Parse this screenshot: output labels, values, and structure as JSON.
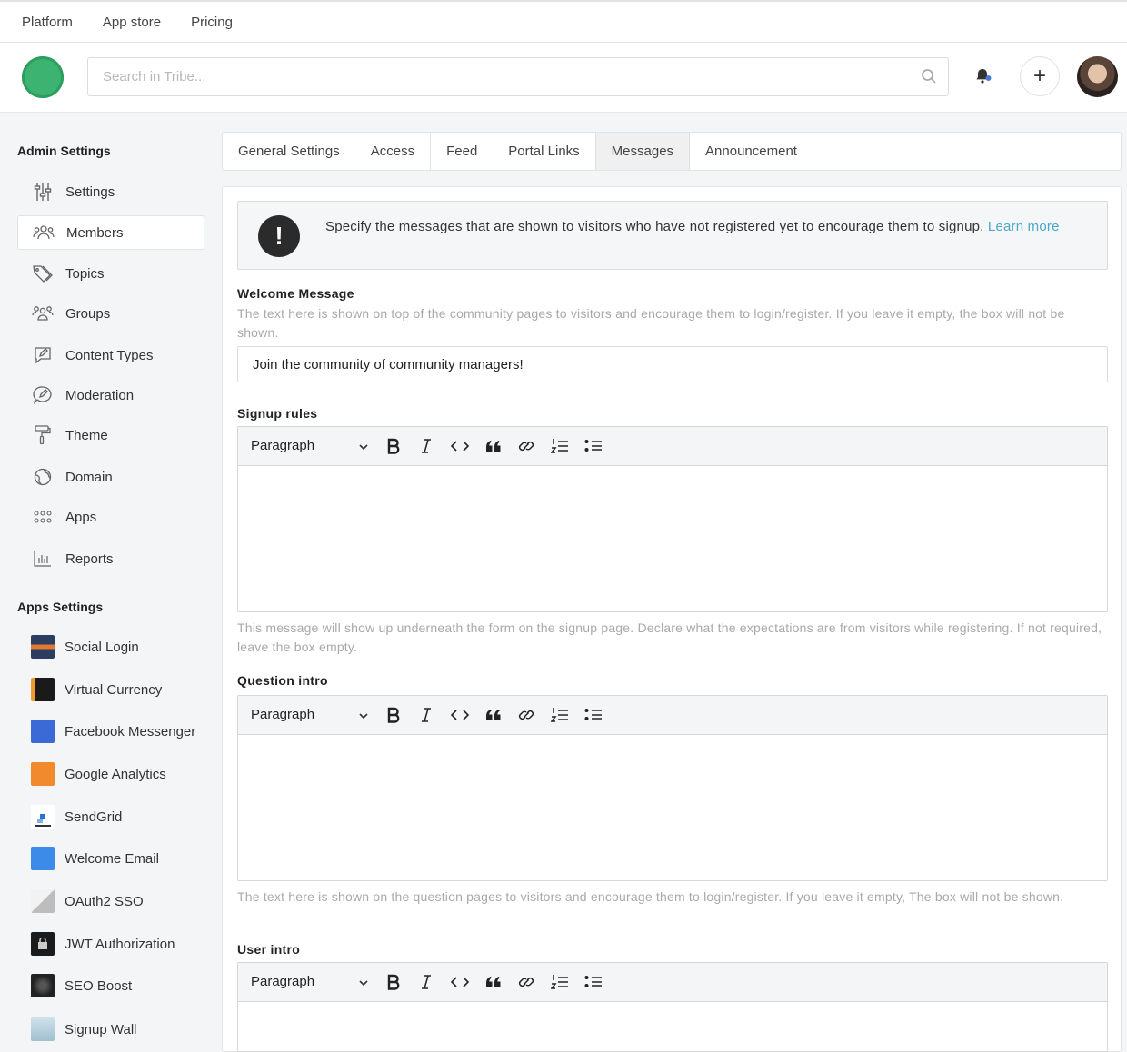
{
  "topnav": {
    "items": [
      "Platform",
      "App store",
      "Pricing"
    ]
  },
  "header": {
    "search_placeholder": "Search in Tribe...",
    "plus_label": "+"
  },
  "sidebar": {
    "admin_heading": "Admin Settings",
    "admin_items": [
      {
        "label": "Settings",
        "icon": "sliders-icon"
      },
      {
        "label": "Members",
        "icon": "members-icon",
        "active": true
      },
      {
        "label": "Topics",
        "icon": "tag-icon"
      },
      {
        "label": "Groups",
        "icon": "groups-icon"
      },
      {
        "label": "Content Types",
        "icon": "edit-icon"
      },
      {
        "label": "Moderation",
        "icon": "moderation-icon"
      },
      {
        "label": "Theme",
        "icon": "paint-roller-icon"
      },
      {
        "label": "Domain",
        "icon": "globe-icon"
      },
      {
        "label": "Apps",
        "icon": "apps-grid-icon"
      },
      {
        "label": "Reports",
        "icon": "bar-chart-icon"
      }
    ],
    "apps_heading": "Apps Settings",
    "app_items": [
      {
        "label": "Social Login",
        "color": "#3a4a6b"
      },
      {
        "label": "Virtual Currency",
        "color": "#1a1a1a"
      },
      {
        "label": "Facebook Messenger",
        "color": "#3b6ad6"
      },
      {
        "label": "Google Analytics",
        "color": "#f08a2c"
      },
      {
        "label": "SendGrid",
        "color": "#ffffff"
      },
      {
        "label": "Welcome Email",
        "color": "#3d8be8"
      },
      {
        "label": "OAuth2 SSO",
        "color": "#e8e8e8"
      },
      {
        "label": "JWT Authorization",
        "color": "#1b1b1b"
      },
      {
        "label": "SEO Boost",
        "color": "#2a2a2a"
      },
      {
        "label": "Signup Wall",
        "color": "#b9d3e0"
      }
    ]
  },
  "tabs": [
    "General Settings",
    "Access",
    "Feed",
    "Portal Links",
    "Messages",
    "Announcement"
  ],
  "alert": {
    "text": "Specify the messages that are shown to visitors who have not registered yet to encourage them to signup.",
    "link": "Learn more"
  },
  "welcome": {
    "label": "Welcome Message",
    "help": "The text here is shown on top of the community pages to visitors and encourage them to login/register. If you leave it empty, the box will not be shown.",
    "value": "Join the community of community managers!"
  },
  "signup_rules": {
    "label": "Signup rules",
    "format": "Paragraph",
    "help": "This message will show up underneath the form on the signup page. Declare what the expectations are from visitors while registering. If not required, leave the box empty."
  },
  "question_intro": {
    "label": "Question intro",
    "format": "Paragraph",
    "help": "The text here is shown on the question pages to visitors and encourage them to login/register. If you leave it empty, The box will not be shown."
  },
  "user_intro": {
    "label": "User intro",
    "format": "Paragraph"
  }
}
